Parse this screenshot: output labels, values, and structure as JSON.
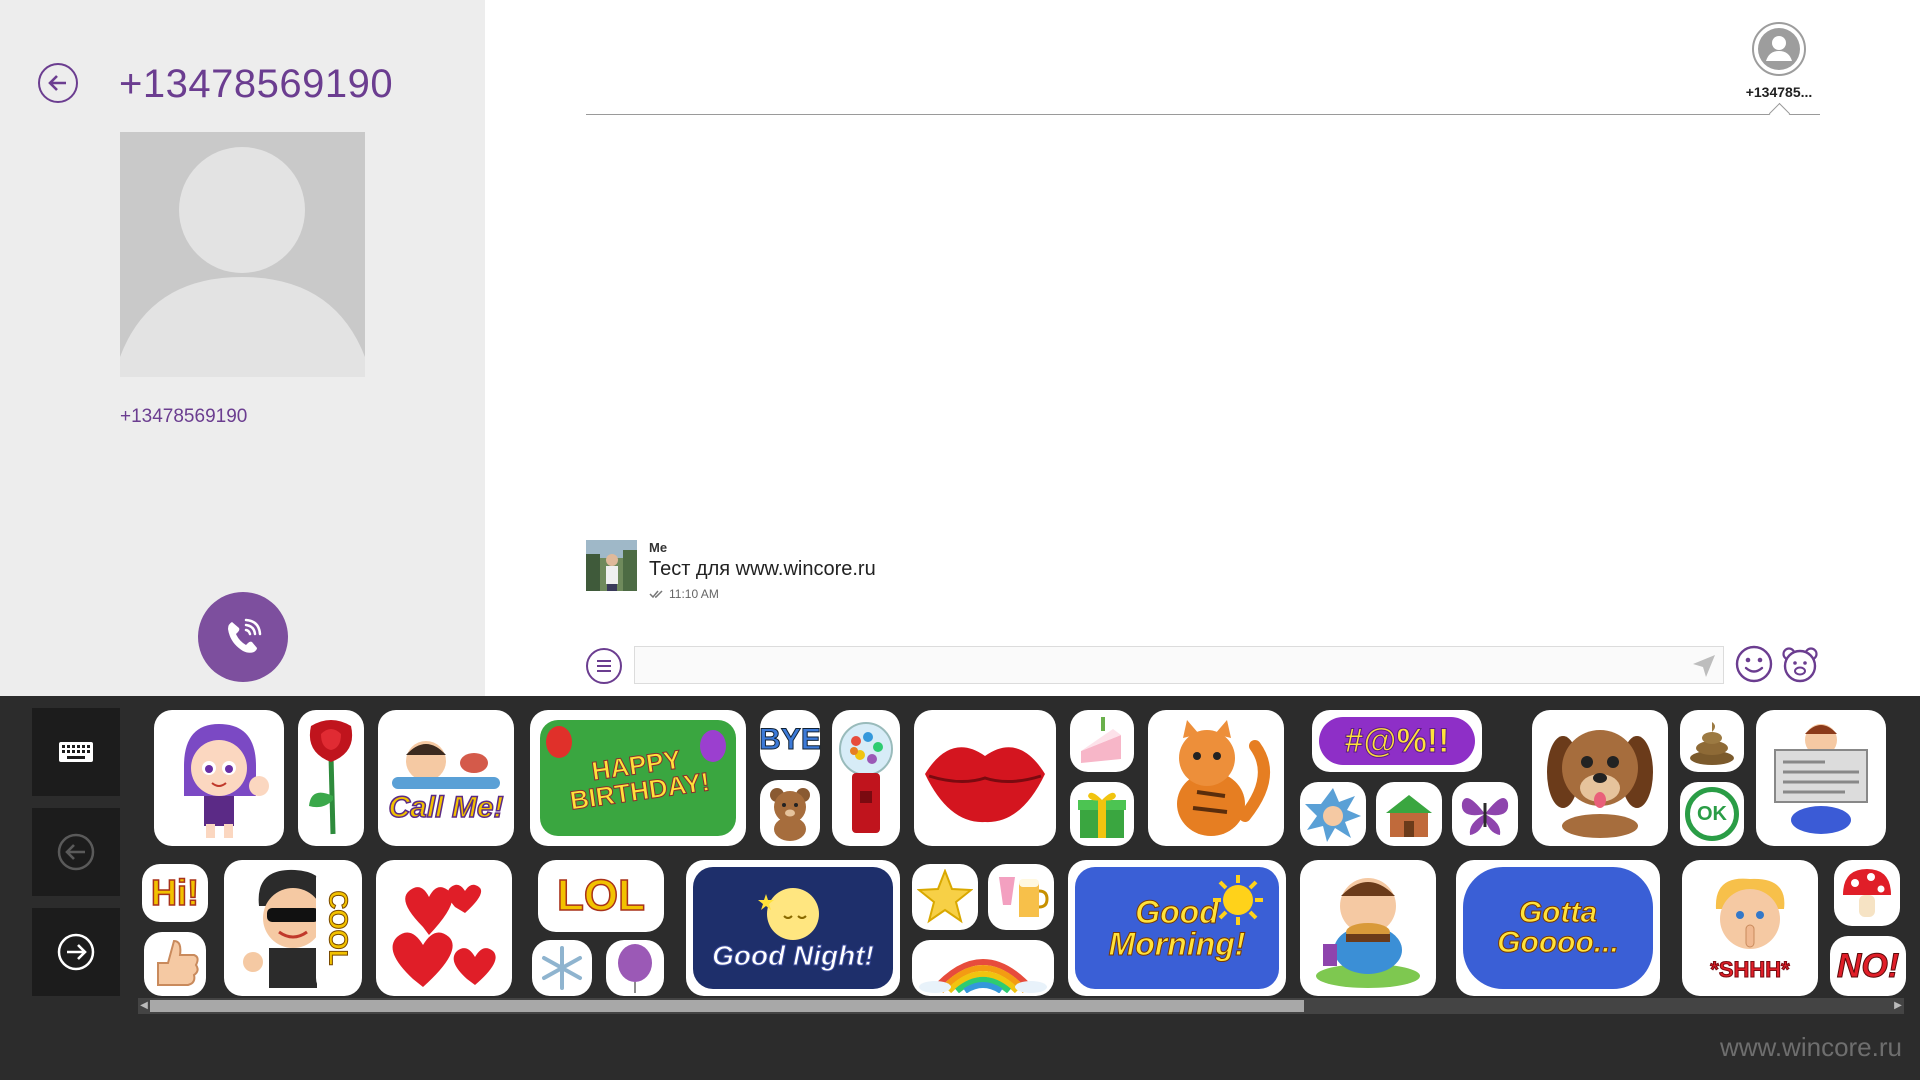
{
  "contact": {
    "title": "+13478569190",
    "number": "+13478569190"
  },
  "participant": {
    "name": "+134785..."
  },
  "message": {
    "sender": "Me",
    "text": "Тест для www.wincore.ru",
    "time": "11:10 AM",
    "status_icon": "double-check-icon"
  },
  "composer": {
    "placeholder": ""
  },
  "stickers": {
    "hi": "Hi!",
    "callme": "Call Me!",
    "birthday": "HAPPY BIRTHDAY!",
    "bye": "BYE",
    "lol": "LOL",
    "goodnight": "Good Night!",
    "goodmorning": "Good Morning!",
    "gotta": "Gotta Goooo...",
    "cool": "COOL",
    "ok": "OK",
    "curse": "#@%!!",
    "shh": "*SHHH*",
    "no": "NO!"
  },
  "footer": {
    "watermark": "www.wincore.ru"
  },
  "colors": {
    "accent": "#6b3d90",
    "call_button": "#7d4f9e",
    "left_pane": "#ededed",
    "sticker_panel": "#2c2c2c"
  }
}
